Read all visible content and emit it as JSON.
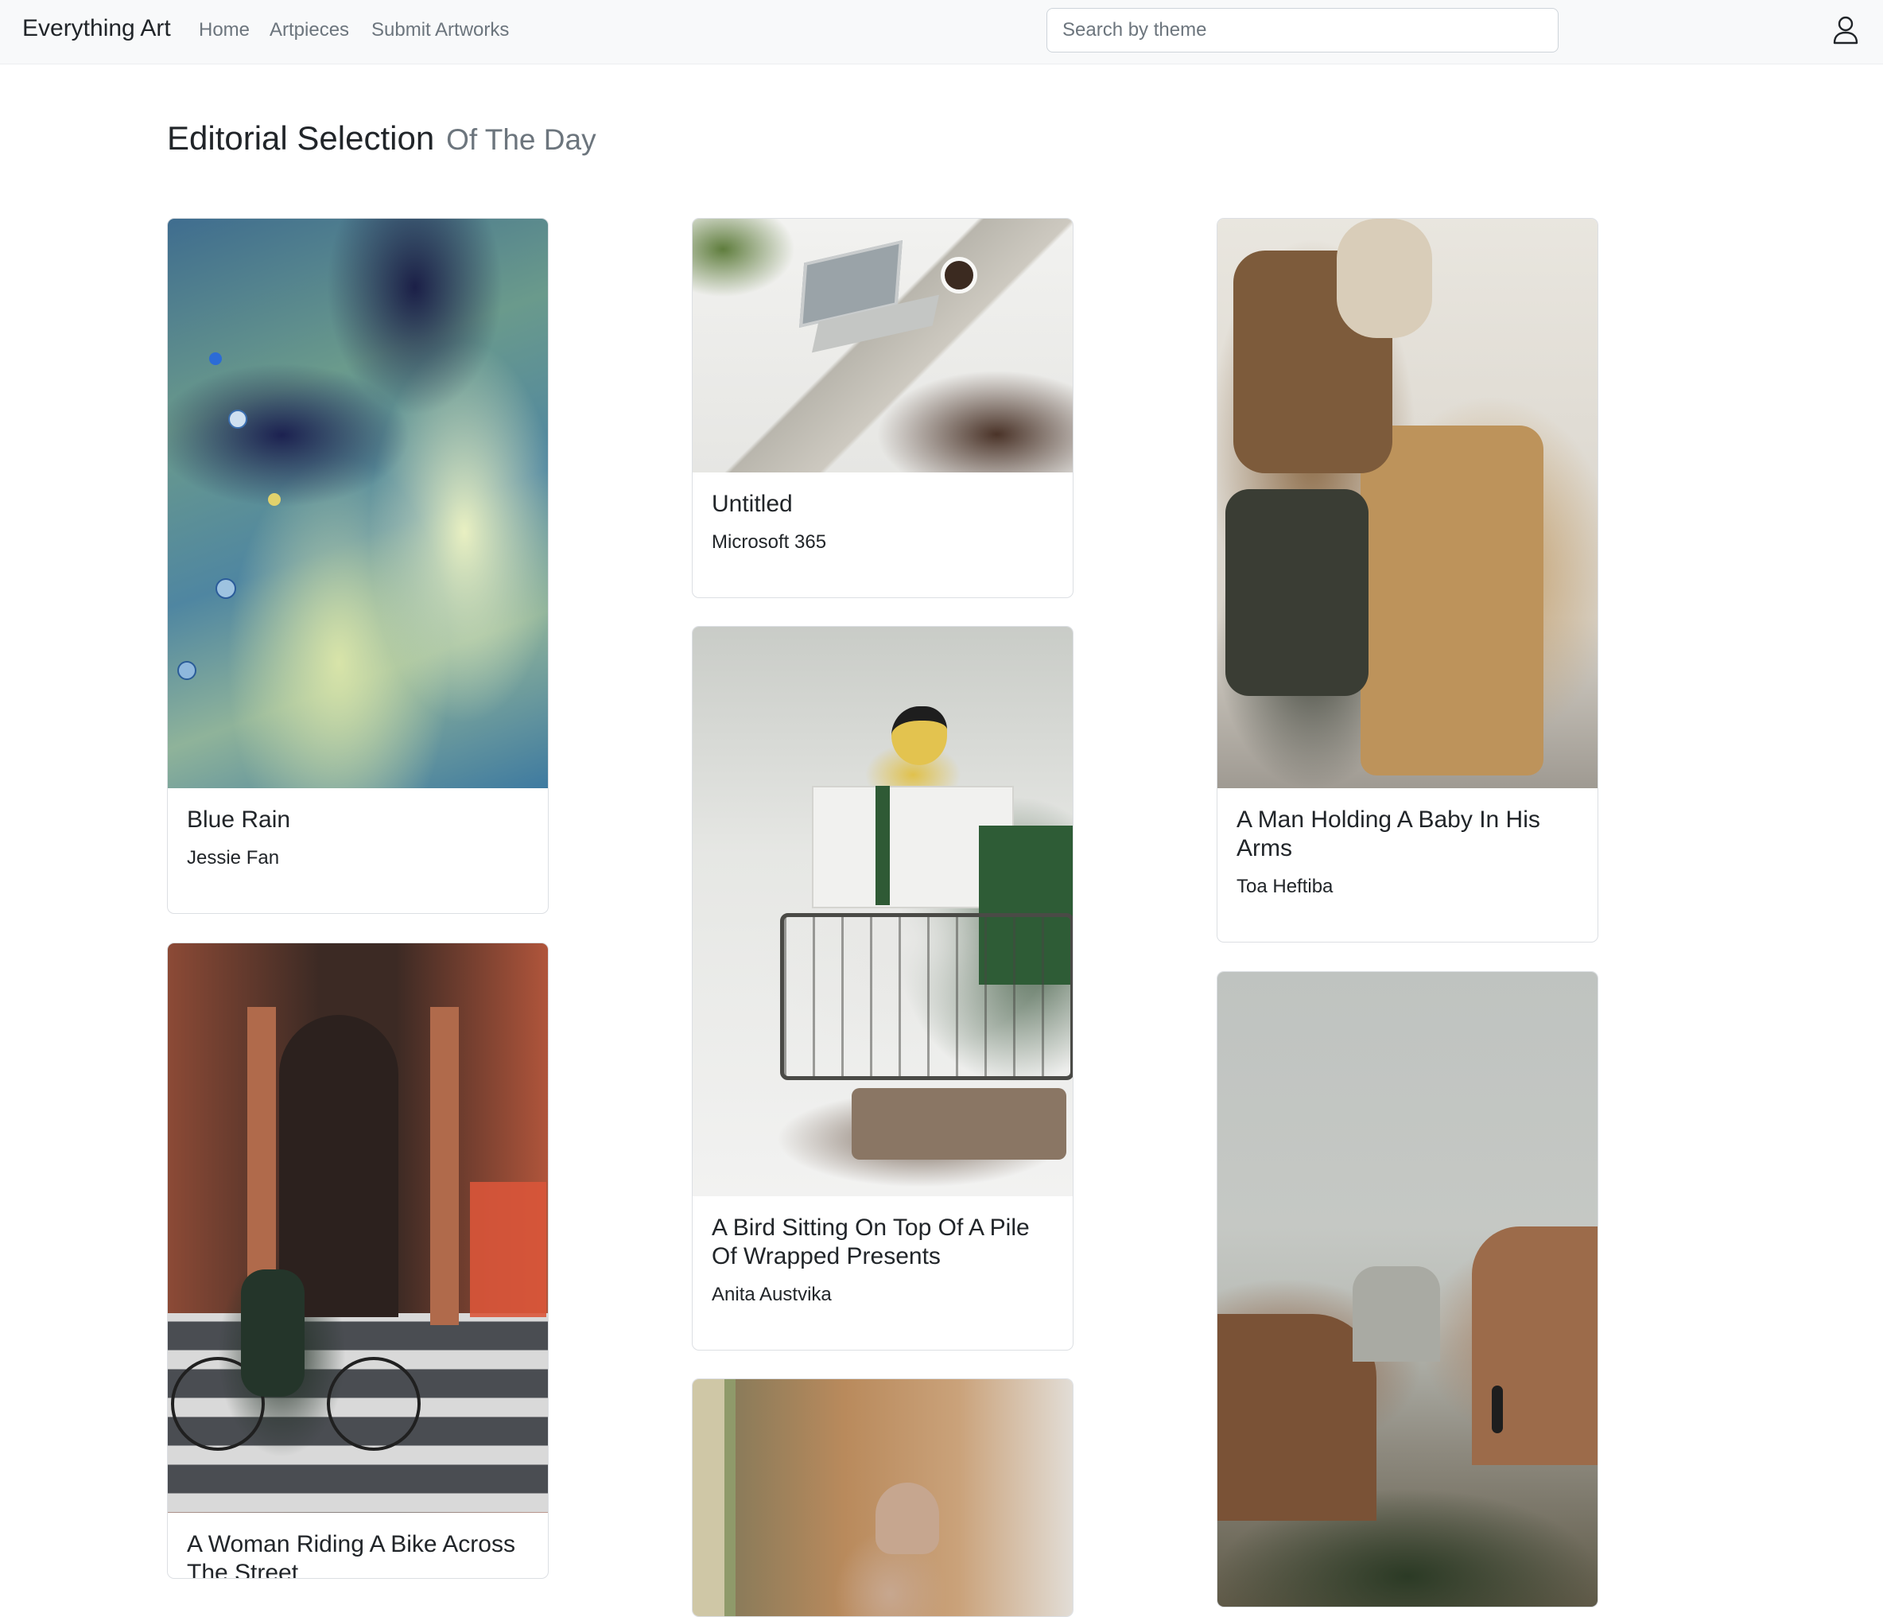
{
  "app": {
    "brand": "Everything Art",
    "nav": [
      {
        "label": "Home"
      },
      {
        "label": "Artpieces"
      },
      {
        "label": "Submit Artworks"
      }
    ],
    "search_placeholder": "Search by theme",
    "user_icon": "user-icon"
  },
  "page": {
    "heading_main": "Editorial Selection",
    "heading_sub": "Of The Day"
  },
  "artworks": [
    {
      "title": "Blue Rain",
      "artist": "Jessie Fan"
    },
    {
      "title": "Untitled",
      "artist": "Microsoft 365"
    },
    {
      "title": "A Man Holding A Baby In His Arms",
      "artist": "Toa Heftiba"
    },
    {
      "title": "A Woman Riding A Bike Across The Street",
      "artist": ""
    },
    {
      "title": "A Bird Sitting On Top Of A Pile Of Wrapped Presents",
      "artist": "Anita Austvika"
    },
    {
      "title": "",
      "artist": ""
    },
    {
      "title": "",
      "artist": ""
    }
  ]
}
